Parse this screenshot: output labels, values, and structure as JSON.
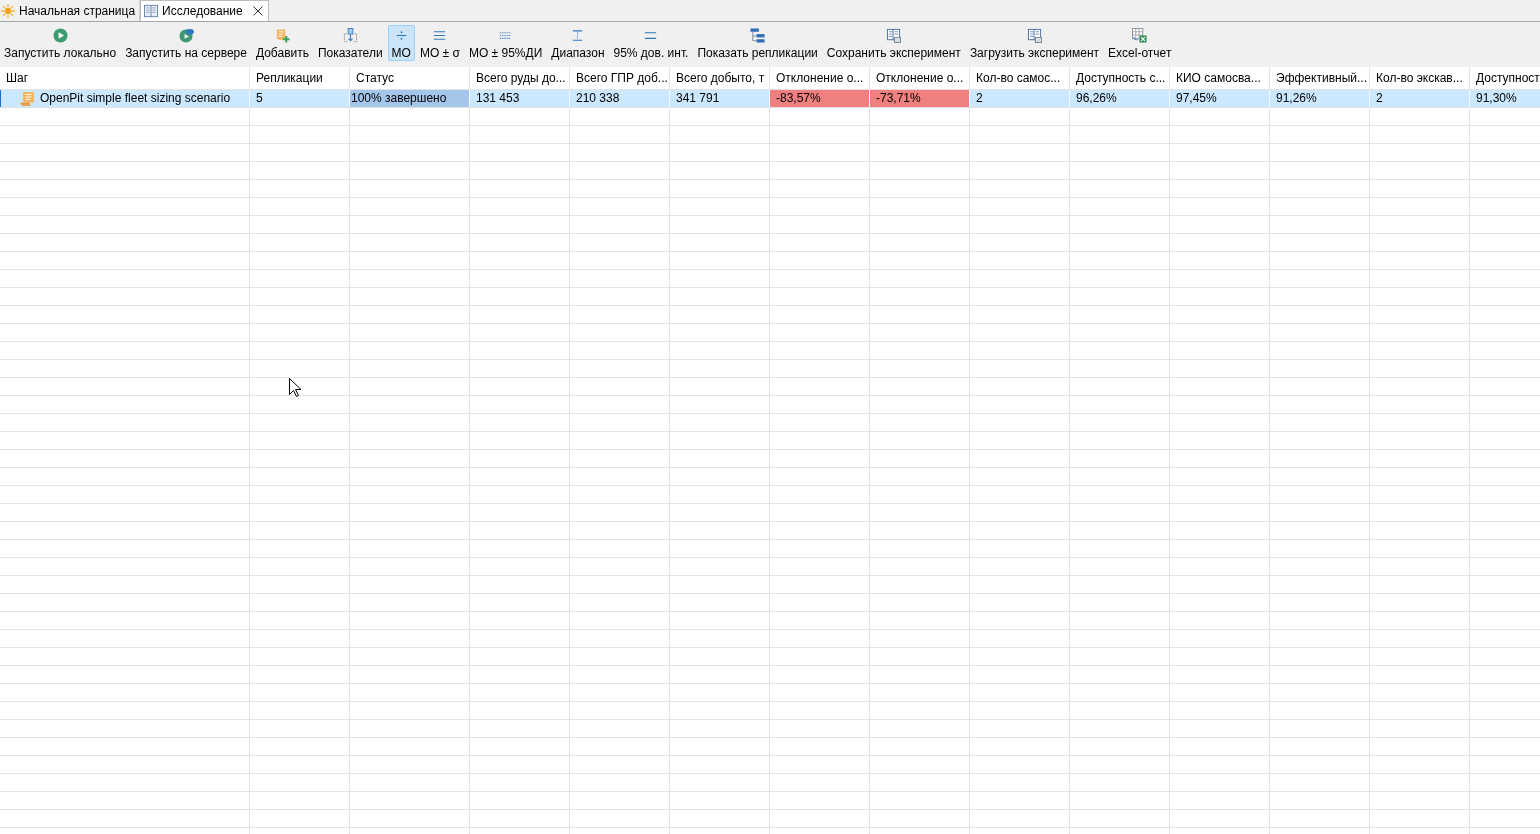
{
  "tabs": [
    {
      "label": "Начальная страница",
      "selected": false,
      "closable": false
    },
    {
      "label": "Исследование",
      "selected": true,
      "closable": true
    }
  ],
  "toolbar": [
    {
      "label": "Запустить локально",
      "selected": false
    },
    {
      "label": "Запустить на сервере",
      "selected": false
    },
    {
      "label": "Добавить",
      "selected": false
    },
    {
      "label": "Показатели",
      "selected": false
    },
    {
      "label": "МО",
      "selected": true
    },
    {
      "label": "МО ± σ",
      "selected": false
    },
    {
      "label": "МО ± 95%ДИ",
      "selected": false
    },
    {
      "label": "Диапазон",
      "selected": false
    },
    {
      "label": "95% дов. инт.",
      "selected": false
    },
    {
      "label": "Показать репликации",
      "selected": false
    },
    {
      "label": "Сохранить эксперимент",
      "selected": false
    },
    {
      "label": "Загрузить эксперимент",
      "selected": false
    },
    {
      "label": "Excel-отчет",
      "selected": false
    }
  ],
  "table": {
    "columns": [
      "Шаг",
      "Репликации",
      "Статус",
      "Всего руды до...",
      "Всего ГПР доб...",
      "Всего добыто, т",
      "Отклонение о...",
      "Отклонение о...",
      "Кол-во самос...",
      "Доступность с...",
      "КИО самосва...",
      "Эффективный...",
      "Кол-во экскав...",
      "Доступност"
    ],
    "rows": [
      {
        "selected": true,
        "cells": [
          {
            "kind": "tree",
            "text": "OpenPit simple fleet sizing scenario"
          },
          {
            "kind": "text",
            "text": "5"
          },
          {
            "kind": "progress",
            "text": "100% завершено",
            "level": 1
          },
          {
            "kind": "text",
            "text": "131 453"
          },
          {
            "kind": "text",
            "text": "210 338"
          },
          {
            "kind": "text",
            "text": "341 791"
          },
          {
            "kind": "text",
            "text": "-83,57%",
            "color": "#f08080"
          },
          {
            "kind": "text",
            "text": "-73,71%",
            "color": "#f08080"
          },
          {
            "kind": "text",
            "text": "2"
          },
          {
            "kind": "text",
            "text": "96,26%"
          },
          {
            "kind": "text",
            "text": "97,45%"
          },
          {
            "kind": "text",
            "text": "91,26%"
          },
          {
            "kind": "text",
            "text": "2"
          },
          {
            "kind": "text",
            "text": "91,30%"
          }
        ]
      }
    ]
  }
}
